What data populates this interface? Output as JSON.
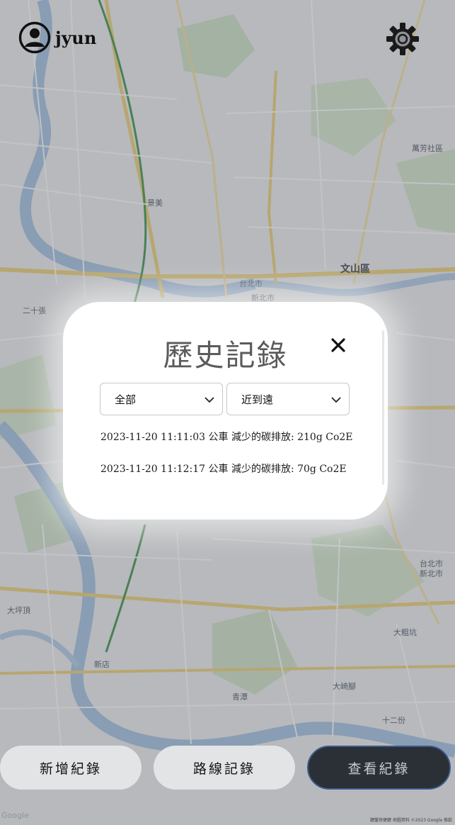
{
  "header": {
    "username": "jyun"
  },
  "icons": {
    "avatar": "user-circle-icon",
    "settings": "gear-icon",
    "close": "close-icon",
    "chevron": "chevron-down-icon"
  },
  "modal": {
    "title": "歷史記錄",
    "filters": {
      "type_selected": "全部",
      "order_selected": "近到遠"
    },
    "records": [
      "2023-11-20 11:11:03 公車 減少的碳排放: 210g Co2E",
      "2023-11-20 11:12:17 公車 減少的碳排放: 70g Co2E"
    ]
  },
  "bottom_buttons": {
    "add": "新增紀錄",
    "route": "路線記錄",
    "view": "查看紀錄"
  },
  "map": {
    "labels": {
      "wenshan": "文山區",
      "taipei": "台北市",
      "xinbei": "新北市",
      "xindian": "新店",
      "jingmei": "景美",
      "wanfang": "萬芳社區",
      "ershizhang": "二十張",
      "qingtan": "青潭",
      "daping": "大坪頂",
      "dalin": "大崎腳",
      "shierfen": "十二份",
      "dazongding": "大粗坑"
    },
    "footer_brand": "Google",
    "footer_attribution": "鍵盤快捷鍵  地圖資料 ©2023 Google  條款"
  },
  "colors": {
    "primary_dark": "#2b2f36",
    "button_light": "#e2e4e6",
    "title_gray": "#5b5b5b"
  }
}
